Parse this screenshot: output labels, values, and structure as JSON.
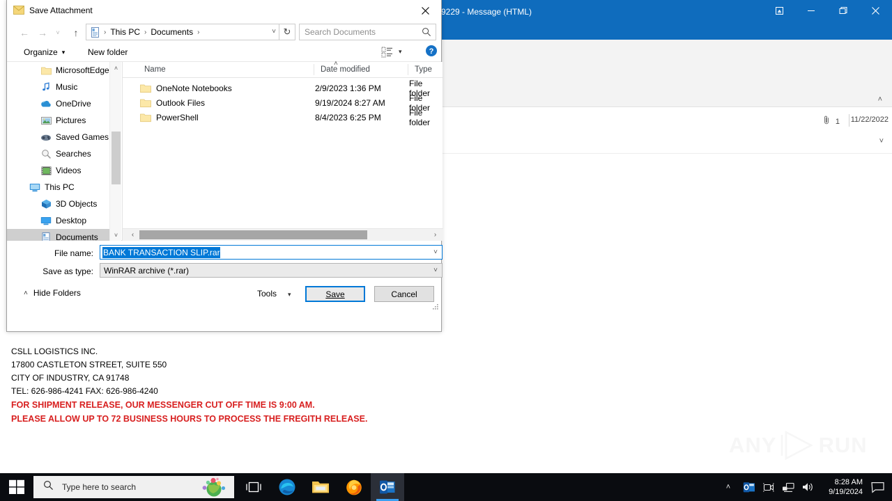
{
  "outlook": {
    "title": "9229  -  Message (HTML)",
    "buttons": {
      "restore_down": "restore-down",
      "minimize": "minimize",
      "maximize": "maximize",
      "close": "close"
    },
    "attachment_count": "1",
    "date": "11/22/2022"
  },
  "email_body": {
    "lines": [
      {
        "text": "CSLL LOGISTICS INC.",
        "style": "normal"
      },
      {
        "text": "17800  CASTLETON STREET, SUITE 550",
        "style": "normal"
      },
      {
        "text": "CITY OF INDUSTRY, CA 91748",
        "style": "normal"
      },
      {
        "text": "TEL: 626-986-4241  FAX: 626-986-4240",
        "style": "normal"
      },
      {
        "text": "FOR SHIPMENT  RELEASE, OUR MESSENGER CUT OFF TIME IS 9:00 AM.",
        "style": "warn"
      },
      {
        "text": "PLEASE ALLOW UP TO 72 BUSINESS  HOURS TO PROCESS  THE FREGITH RELEASE.",
        "style": "warn"
      }
    ],
    "warn_color": "#d81f1f"
  },
  "dialog": {
    "title": "Save Attachment",
    "close_label": "✕",
    "nav": {
      "back": "←",
      "forward": "→",
      "recent": "˅",
      "up": "↑",
      "refresh": "↻",
      "dropdown": "˅"
    },
    "breadcrumbs": [
      "This PC",
      "Documents"
    ],
    "breadcrumb_separator": "›",
    "search": {
      "placeholder": "Search Documents",
      "icon": "search-icon"
    },
    "commandbar": {
      "organize": "Organize",
      "organize_caret": "▾",
      "new_folder": "New folder",
      "view_caret": "▾",
      "help": "?"
    },
    "nav_pane": {
      "items": [
        {
          "label": "MicrosoftEdge",
          "icon": "folder-icon",
          "depth": 1,
          "selected": false
        },
        {
          "label": "Music",
          "icon": "music-icon",
          "depth": 1,
          "selected": false
        },
        {
          "label": "OneDrive",
          "icon": "onedrive-icon",
          "depth": 1,
          "selected": false
        },
        {
          "label": "Pictures",
          "icon": "pictures-icon",
          "depth": 1,
          "selected": false
        },
        {
          "label": "Saved Games",
          "icon": "saved-games-icon",
          "depth": 1,
          "selected": false
        },
        {
          "label": "Searches",
          "icon": "searches-icon",
          "depth": 1,
          "selected": false
        },
        {
          "label": "Videos",
          "icon": "videos-icon",
          "depth": 1,
          "selected": false
        },
        {
          "label": "This PC",
          "icon": "this-pc-icon",
          "depth": 0,
          "selected": false
        },
        {
          "label": "3D Objects",
          "icon": "3d-objects-icon",
          "depth": 1,
          "selected": false
        },
        {
          "label": "Desktop",
          "icon": "desktop-icon",
          "depth": 1,
          "selected": false
        },
        {
          "label": "Documents",
          "icon": "documents-icon",
          "depth": 1,
          "selected": true
        }
      ],
      "scroll_up": "˄",
      "scroll_down": "˅"
    },
    "file_list": {
      "columns": [
        "Name",
        "Date modified",
        "Type"
      ],
      "sort_indicator": "˄",
      "rows": [
        {
          "name": "OneNote Notebooks",
          "date": "2/9/2023 1:36 PM",
          "type": "File folder"
        },
        {
          "name": "Outlook Files",
          "date": "9/19/2024 8:27 AM",
          "type": "File folder"
        },
        {
          "name": "PowerShell",
          "date": "8/4/2023 6:25 PM",
          "type": "File folder"
        }
      ],
      "hscroll_left": "‹",
      "hscroll_right": "›"
    },
    "form": {
      "filename_label": "File name:",
      "filename_value": "BANK TRANSACTION SLIP.rar",
      "filename_selected": true,
      "savetype_label": "Save as type:",
      "savetype_value": "WinRAR archive (*.rar)",
      "dropdown_caret": "˅",
      "selection_color": "#0078d7"
    },
    "footer": {
      "hide_folders": "Hide Folders",
      "hide_folders_chevron": "˄",
      "tools": "Tools",
      "tools_caret": "▾",
      "save": "Save",
      "cancel": "Cancel"
    }
  },
  "taskbar": {
    "start": "start-icon",
    "search_placeholder": "Type here to search",
    "items": [
      {
        "name": "task-view",
        "label": "Task View"
      },
      {
        "name": "edge",
        "label": "Microsoft Edge"
      },
      {
        "name": "file-explorer",
        "label": "File Explorer"
      },
      {
        "name": "firefox",
        "label": "Firefox"
      },
      {
        "name": "outlook",
        "label": "Outlook"
      }
    ],
    "tray": {
      "chevron": "˄",
      "time": "8:28 AM",
      "date": "9/19/2024"
    }
  },
  "watermark": {
    "left_text": "ANY",
    "right_text": "RUN"
  }
}
